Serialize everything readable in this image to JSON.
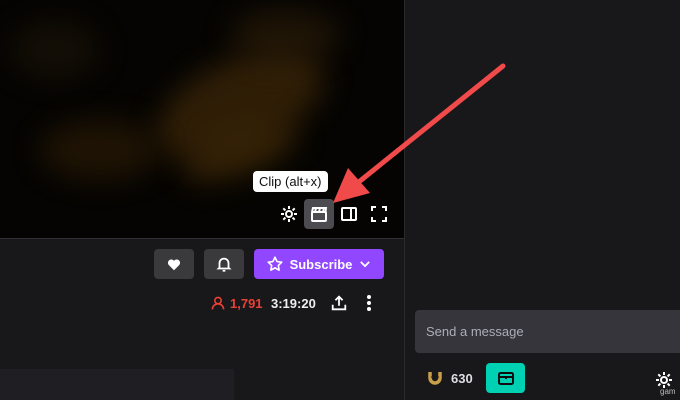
{
  "player": {
    "tooltip": "Clip (alt+x)",
    "controls": [
      {
        "icon": "gear-icon"
      },
      {
        "icon": "clip-icon"
      },
      {
        "icon": "theatre-mode-icon"
      },
      {
        "icon": "fullscreen-icon"
      }
    ]
  },
  "actions": {
    "follow_icon": "heart-icon",
    "notify_icon": "bell-icon",
    "subscribe_label": "Subscribe"
  },
  "stats": {
    "viewers": "1,791",
    "uptime": "3:19:20"
  },
  "chat": {
    "placeholder": "Send a message",
    "points": "630"
  },
  "colors": {
    "accent": "#9147ff",
    "viewer_red": "#eb4034",
    "teal": "#00d1b2",
    "arrow": "#f04a4a"
  },
  "watermark": "gam"
}
